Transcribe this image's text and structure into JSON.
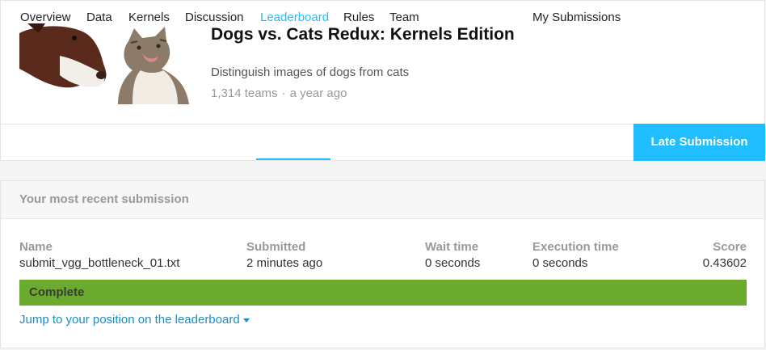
{
  "competition": {
    "title": "Dogs vs. Cats Redux: Kernels Edition",
    "subtitle": "Distinguish images of dogs from cats",
    "teams": "1,314 teams",
    "separator": "·",
    "age": "a year ago"
  },
  "tabs": [
    {
      "label": "Overview",
      "active": false
    },
    {
      "label": "Data",
      "active": false
    },
    {
      "label": "Kernels",
      "active": false
    },
    {
      "label": "Discussion",
      "active": false
    },
    {
      "label": "Leaderboard",
      "active": true
    },
    {
      "label": "Rules",
      "active": false
    },
    {
      "label": "Team",
      "active": false
    }
  ],
  "actions": {
    "my_submissions": "My Submissions",
    "late_submission": "Late Submission"
  },
  "submission": {
    "header": "Your most recent submission",
    "columns": {
      "name": "Name",
      "submitted": "Submitted",
      "wait_time": "Wait time",
      "execution_time": "Execution time",
      "score": "Score"
    },
    "values": {
      "name": "submit_vgg_bottleneck_01.txt",
      "submitted": "2 minutes ago",
      "wait_time": "0 seconds",
      "execution_time": "0 seconds",
      "score": "0.43602"
    },
    "status": "Complete",
    "jump_link": "Jump to your position on the leaderboard"
  },
  "colors": {
    "accent": "#20beff",
    "status_complete": "#6aab2e",
    "link": "#1a8cc6"
  }
}
